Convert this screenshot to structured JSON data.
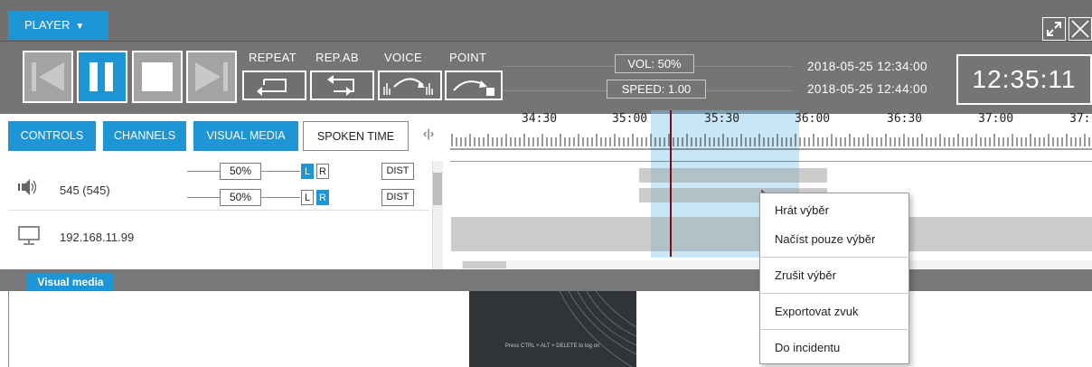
{
  "header": {
    "player_label": "PLAYER",
    "restore_icon": "restore-down-icon",
    "close_icon": "close-icon"
  },
  "transport": {
    "buttons": [
      {
        "name": "skip-back",
        "icon": "skip-back-icon"
      },
      {
        "name": "pause",
        "icon": "pause-icon",
        "active": true
      },
      {
        "name": "stop",
        "icon": "stop-icon"
      },
      {
        "name": "skip-forward",
        "icon": "skip-forward-icon"
      }
    ],
    "modes": {
      "repeat": "REPEAT",
      "rep_ab": "REP.AB",
      "voice": "VOICE",
      "point": "POINT"
    },
    "volume": "VOL: 50%",
    "speed": "SPEED: 1.00",
    "start_date": "2018-05-25 12:34:00",
    "end_date": "2018-05-25 12:44:00",
    "clock": "12:35:11"
  },
  "tabs": [
    {
      "label": "CONTROLS",
      "active": true
    },
    {
      "label": "CHANNELS",
      "active": true
    },
    {
      "label": "VISUAL MEDIA",
      "active": true
    },
    {
      "label": "SPOKEN TIME",
      "active": false
    }
  ],
  "timeline": {
    "ticks": [
      "34:30",
      "35:00",
      "35:30",
      "36:00",
      "36:30",
      "37:00",
      "37:"
    ]
  },
  "channels": [
    {
      "icon": "speaker-icon",
      "label": "545 (545)",
      "rows": [
        {
          "level": "50%",
          "l_on": true,
          "r_on": false,
          "dist": "DIST"
        },
        {
          "level": "50%",
          "l_on": false,
          "r_on": true,
          "dist": "DIST"
        }
      ]
    },
    {
      "icon": "monitor-icon",
      "label": "192.168.11.99"
    }
  ],
  "lr": {
    "l": "L",
    "r": "R"
  },
  "visual_media": {
    "tab_label": "Visual media",
    "thumbnail_caption": "Press CTRL + ALT + DELETE to log on"
  },
  "context_menu": {
    "items": [
      "Hrát výběr",
      "Načíst pouze výběr",
      "Zrušit výběr",
      "Exportovat zvuk",
      "Do incidentu"
    ]
  },
  "colors": {
    "accent": "#1e95d4",
    "panel": "#757575",
    "selection": "#87c8ea",
    "playhead": "#7b0d0d"
  }
}
